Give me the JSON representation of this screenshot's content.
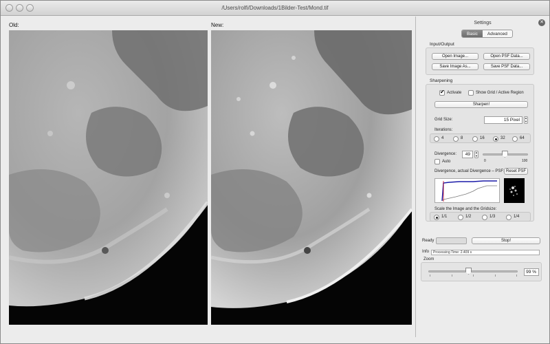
{
  "window": {
    "title": "/Users/rolfi/Downloads/1Bilder-Test/Mond.tif"
  },
  "panels": {
    "old_label": "Old:",
    "new_label": "New:"
  },
  "settings": {
    "title": "Settings",
    "close_icon": "close-icon",
    "tabs": [
      {
        "label": "Basic",
        "active": true
      },
      {
        "label": "Advanced",
        "active": false
      }
    ],
    "io": {
      "title": "Input/Output",
      "open_image": "Open Image...",
      "open_psf": "Open PSF Data...",
      "save_image": "Save Image As...",
      "save_psf": "Save PSF Data..."
    },
    "sharpening": {
      "title": "Sharpening",
      "activate_label": "Activate",
      "activate_checked": true,
      "show_grid_label": "Show Grid / Active Region",
      "show_grid_checked": false,
      "sharpen_button": "Sharpen!",
      "grid_size_label": "Grid Size:",
      "grid_size_value": "15 Pixel",
      "iterations_label": "Iterations:",
      "iterations_options": [
        "4",
        "8",
        "16",
        "32",
        "64"
      ],
      "iterations_selected": "32",
      "divergence_label": "Divergence:",
      "divergence_value": "49",
      "divergence_level": 0.49,
      "divergence_min": "0",
      "divergence_max": "100",
      "auto_label": "Auto",
      "auto_checked": false,
      "divergence_psf_label": "Divergence, actual Divergence – PSF:",
      "reset_psf_button": "Reset PSF",
      "scale_label": "Scale the Image and the Gridsize:",
      "scale_options": [
        "1/1",
        "1/2",
        "1/3",
        "1/4"
      ],
      "scale_selected": "1/1"
    },
    "status": {
      "ready_label": "Ready",
      "stop_button": "Stop!",
      "info_label": "Info",
      "info_value": "Processing Time: 2.409 s"
    },
    "zoom": {
      "label": "Zoom",
      "value": "99 %",
      "level": 0.45
    }
  },
  "colors": {
    "graph_divergence": "#1a1aa8",
    "graph_actual": "#7a7a7a"
  }
}
